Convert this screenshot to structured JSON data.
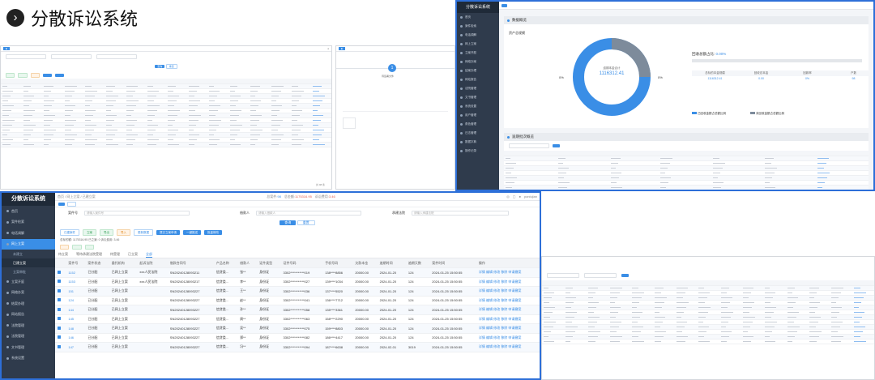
{
  "header": {
    "title": "分散诉讼系统"
  },
  "colors": {
    "accent": "#2d6fd8",
    "sidebar": "#2f3b4c",
    "primary": "#3a8ee6"
  },
  "main": {
    "brand": "分散诉讼系统",
    "breadcrumb": "首页 / 网上立案 / 已建立案",
    "user": "panlujian",
    "status": {
      "total_label": "总案件:",
      "total": "98",
      "amount_label": "总金额:",
      "amount": "1175316.95",
      "claim_label": "诉讼费用:",
      "claim": "3.46"
    },
    "sidebar": [
      {
        "label": "首页",
        "icon": "home-icon"
      },
      {
        "label": "案件检索",
        "icon": "search-icon"
      },
      {
        "label": "电话调解",
        "icon": "phone-icon"
      },
      {
        "label": "网上立案",
        "icon": "folder-icon",
        "active": true
      },
      {
        "label": "未建立",
        "sub": true
      },
      {
        "label": "已建立案",
        "sub": true,
        "on": true
      },
      {
        "label": "立案审批",
        "sub": true
      },
      {
        "label": "立案开庭",
        "icon": "calendar-icon"
      },
      {
        "label": "网络办案",
        "icon": "doc-icon"
      },
      {
        "label": "结案办理",
        "icon": "check-icon"
      },
      {
        "label": "网站报告",
        "icon": "chart-icon"
      },
      {
        "label": "法院管理",
        "icon": "court-icon"
      },
      {
        "label": "法院管理",
        "icon": "court-icon"
      },
      {
        "label": "文书管理",
        "icon": "file-icon"
      },
      {
        "label": "系统设置",
        "icon": "gear-icon"
      }
    ],
    "filters": {
      "case_no_label": "案件号",
      "case_no_ph": "请输入案件号",
      "party_label": "借款人",
      "party_ph": "请输入借款人",
      "court_label": "承建法院",
      "court_ph": "请输入承建法院",
      "search": "查询",
      "reset": "重置"
    },
    "actions": [
      "已建案件",
      "立案",
      "导出",
      "导入",
      "更新数据",
      "提交立案申请",
      "一键推送",
      "批量修改"
    ],
    "summary": "总标的额: 1175316.95   已立案: 0   诉讼费用: 3.46",
    "tabs": [
      "待立案",
      "等待承建法院受理",
      "待受理",
      "已立案",
      "全部"
    ],
    "columns": [
      "案件号",
      "案件状态",
      "委托机构",
      "起诉法院",
      "借款合同号",
      "产品名称",
      "借款人",
      "证件类型",
      "证件号码",
      "手机号码",
      "欠款本金",
      "逾期时间",
      "逾期天数",
      "案件时间",
      "操作"
    ],
    "rows": [
      {
        "no": "1152",
        "status": "已分配",
        "org": "已网上立案",
        "court": "xxx人民法院",
        "contract": "SN20240128093211",
        "product": "信贷类...",
        "party": "张**",
        "idtype": "身份证",
        "id": "3302***********019",
        "phone": "138****8856",
        "principal": "20000.00",
        "due": "2024-01-20",
        "days": "124",
        "time": "2024-01-25 15:50:55",
        "ops": "详情 编辑 修改 移除 申请撤案"
      },
      {
        "no": "1153",
        "status": "已分配",
        "org": "已网上立案",
        "court": "xxx人民法院",
        "contract": "SN20240128093217",
        "product": "信贷类...",
        "party": "李**",
        "idtype": "身份证",
        "id": "3302***********027",
        "phone": "139****1034",
        "principal": "20000.00",
        "due": "2024-01-20",
        "days": "124",
        "time": "2024-01-25 15:50:55",
        "ops": "详情 编辑 修改 移除 申请撤案"
      },
      {
        "no": "151",
        "status": "已分配",
        "org": "已网上立案",
        "court": "",
        "contract": "SN20240128093227",
        "product": "信贷类...",
        "party": "王**",
        "idtype": "身份证",
        "id": "3302***********036",
        "phone": "137****5520",
        "principal": "20000.00",
        "due": "2024-01-20",
        "days": "124",
        "time": "2024-01-25 15:50:55",
        "ops": "详情 编辑 修改 移除 申请撤案"
      },
      {
        "no": "124",
        "status": "已分配",
        "org": "已网上立案",
        "court": "",
        "contract": "SN20240128093227",
        "product": "信贷类...",
        "party": "赵**",
        "idtype": "身份证",
        "id": "3302***********041",
        "phone": "136****7712",
        "principal": "20000.00",
        "due": "2024-01-20",
        "days": "124",
        "time": "2024-01-25 15:50:55",
        "ops": "详情 编辑 修改 移除 申请撤案"
      },
      {
        "no": "144",
        "status": "已分配",
        "org": "已网上立案",
        "court": "",
        "contract": "SN20240128093227",
        "product": "信贷类...",
        "party": "孙**",
        "idtype": "身份证",
        "id": "3302***********058",
        "phone": "135****3361",
        "principal": "20000.00",
        "due": "2024-01-20",
        "days": "124",
        "time": "2024-01-25 15:50:55",
        "ops": "详情 编辑 修改 移除 申请撤案"
      },
      {
        "no": "145",
        "status": "已分配",
        "org": "已网上立案",
        "court": "",
        "contract": "SN20240128093227",
        "product": "信贷类...",
        "party": "周**",
        "idtype": "身份证",
        "id": "3302***********063",
        "phone": "158****2290",
        "principal": "20000.00",
        "due": "2024-01-20",
        "days": "124",
        "time": "2024-01-25 15:50:55",
        "ops": "详情 编辑 修改 移除 申请撤案"
      },
      {
        "no": "148",
        "status": "已分配",
        "org": "已网上立案",
        "court": "",
        "contract": "SN20240128093227",
        "product": "信贷类...",
        "party": "吴**",
        "idtype": "身份证",
        "id": "3302***********075",
        "phone": "159****8803",
        "principal": "20000.00",
        "due": "2024-01-20",
        "days": "124",
        "time": "2024-01-25 15:50:55",
        "ops": "详情 编辑 修改 移除 申请撤案"
      },
      {
        "no": "146",
        "status": "已分配",
        "org": "已网上立案",
        "court": "",
        "contract": "SN20240128093227",
        "product": "信贷类...",
        "party": "郑**",
        "idtype": "身份证",
        "id": "3302***********082",
        "phone": "186****4417",
        "principal": "20000.00",
        "due": "2024-01-20",
        "days": "124",
        "time": "2024-01-25 15:50:55",
        "ops": "详情 编辑 修改 移除 申请撤案"
      },
      {
        "no": "147",
        "status": "已分配",
        "org": "已网上立案",
        "court": "",
        "contract": "SN20240128093227",
        "product": "信贷类...",
        "party": "冯**",
        "idtype": "身份证",
        "id": "3302***********094",
        "phone": "187****6638",
        "principal": "20000.00",
        "due": "2024-02-01",
        "days": "3019",
        "time": "2024-01-25 15:50:55",
        "ops": "详情 编辑 修改 移除 申请撤案"
      }
    ]
  },
  "dashboard": {
    "brand": "分散诉讼系统",
    "section1": "数据概览",
    "asset_label": "资产总规模",
    "ring_caption": "逾期本金合计",
    "ring_value": "1116312.41",
    "left_pct": "0%",
    "right_pct": "0%",
    "progress_label": "回收总额占比:",
    "progress_value": "0.00%",
    "stats": [
      {
        "label": "总标的本金规模",
        "value": "1116312.41"
      },
      {
        "label": "回收总本金",
        "value": "0.00"
      },
      {
        "label": "回款率",
        "value": "0%"
      },
      {
        "label": "户数",
        "value": "98"
      }
    ],
    "legend": [
      "已回收金额占总额比例",
      "未回收金额占总额比例"
    ],
    "section2": "逾期批次概览",
    "side_items": [
      "首页",
      "案件检索",
      "电话调解",
      "网上立案",
      "立案开庭",
      "网络办案",
      "结案办理",
      "网站报告",
      "法院管理",
      "文书管理",
      "系统设置",
      "用户管理",
      "角色管理",
      "日志管理",
      "数据字典",
      "操作记录"
    ]
  },
  "panel_a": {
    "search": "查询",
    "reset": "重置",
    "pager": "共 98 条"
  },
  "panel_b": {
    "step": "1",
    "step_label": "待签署文件"
  }
}
